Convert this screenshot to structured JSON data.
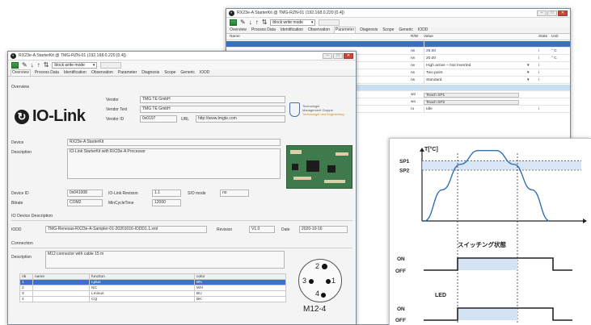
{
  "back_window": {
    "title": "RX23e-A StarterKit  @ TMG-RZN-01 (192.168.0.220 [0.4])",
    "mode": "block write mode",
    "tabs": [
      "Overview",
      "Process Data",
      "Identification",
      "Observation",
      "Parameter",
      "Diagnosis",
      "Scope",
      "Generic",
      "IODD"
    ],
    "active_tab": "Parameter",
    "columns": {
      "name": "Name",
      "rw": "R/W",
      "value": "Value",
      "state": "State",
      "unit": "Unit"
    },
    "rows": [
      {
        "rw": "",
        "value": "",
        "state": "",
        "unit": ""
      },
      {
        "rw": "rw",
        "value": "25.00",
        "state": "i",
        "unit": "° C"
      },
      {
        "rw": "rw",
        "value": "20.00",
        "state": "i",
        "unit": "° C"
      },
      {
        "rw": "rw",
        "value": "High active ~ Not Inverted",
        "state": "i",
        "unit": ""
      },
      {
        "rw": "rw",
        "value": "Two point",
        "state": "i",
        "unit": ""
      },
      {
        "rw": "rw",
        "value": "Standard",
        "state": "i",
        "unit": ""
      },
      {
        "rw": "",
        "value": "",
        "state": "",
        "unit": ""
      },
      {
        "rw": "wo",
        "value": "Teach SP1",
        "state": "",
        "unit": ""
      },
      {
        "rw": "wo",
        "value": "Teach SP2",
        "state": "",
        "unit": ""
      },
      {
        "rw": "ro",
        "value": "Idle",
        "state": "i",
        "unit": ""
      }
    ]
  },
  "front_window": {
    "title": "RX23e-A StarterKit  @ TMG-RZN-01 (192.168.0.220 [0.4])",
    "mode": "block write mode",
    "tabs": [
      "Overview",
      "Process Data",
      "Identification",
      "Observation",
      "Parameter",
      "Diagnosis",
      "Scope",
      "Generic",
      "IODD"
    ],
    "active_tab": "Overview",
    "overview_label": "Overview",
    "logo_text": "IO-Link",
    "vendor": {
      "vendor_label": "Vendor",
      "vendor_value": "TMG TE GmbH",
      "text_label": "Vendor Text",
      "text_value": "TMG TE GmbH",
      "id_label": "Vendor ID",
      "id_value": "0x0197",
      "url_label": "URL",
      "url_value": "http://www.tmgte.com"
    },
    "tmg_logo": {
      "line1": "Technologie",
      "line2": "Management Gruppe",
      "line3": "Technologie und Engineering"
    },
    "device": {
      "device_label": "Device",
      "device_value": "RX23e-A StarterKit",
      "desc_label": "Description",
      "desc_value": "IO-Link StarterKit with RX23e-A Processor"
    },
    "ids": {
      "device_id_label": "Device ID",
      "device_id_value": "0x041008",
      "revision_label": "IO-Link Revision",
      "revision_value": "1.1",
      "sio_label": "SIO mode",
      "sio_value": "no",
      "bitrate_label": "Bitrate",
      "bitrate_value": "COM2",
      "cycle_label": "MinCycleTime",
      "cycle_value": "12000"
    },
    "iodd": {
      "section_label": "IO Device Description",
      "iodd_label": "IODD",
      "iodd_value": "TMG-Renesas-RX23e-A-Sampler-01-20201016-IODD1.1.xml",
      "revision_label": "Revision",
      "revision_value": "V1.0",
      "date_label": "Date",
      "date_value": "2020-10-16"
    },
    "connection": {
      "section_label": "Connection",
      "desc_label": "Description",
      "desc_value": "M12 connector with cable 15 m",
      "columns": [
        "nb",
        "name",
        "function",
        "color"
      ],
      "rows": [
        [
          "1",
          "",
          "Lplus",
          "BN"
        ],
        [
          "2",
          "",
          "NC",
          "WH"
        ],
        [
          "3",
          "",
          "Lminus",
          "BU"
        ],
        [
          "4",
          "",
          "CQ",
          "BK"
        ]
      ],
      "connector_label": "M12-4",
      "pins": [
        "1",
        "2",
        "3",
        "4"
      ]
    }
  },
  "chart_data": {
    "type": "line",
    "ylabel": "T[°C]",
    "y_ticks": [
      "SP1",
      "SP2"
    ],
    "series": [
      {
        "values": [
          0.0,
          0.43,
          0.78,
          0.97,
          0.97,
          0.78,
          0.43,
          0.0
        ]
      }
    ],
    "x": [
      0,
      1,
      2,
      3,
      4,
      5,
      6,
      7
    ],
    "sp1": 0.83,
    "sp2": 0.7,
    "switch_title": "スイッチング状態",
    "switch_on_label": "ON",
    "switch_off_label": "OFF",
    "switch_states": [
      0,
      1,
      1,
      0
    ],
    "led_title": "LED",
    "led_on_label": "ON",
    "led_off_label": "OFF",
    "led_states": [
      0,
      1,
      1,
      0
    ],
    "grid": false
  }
}
